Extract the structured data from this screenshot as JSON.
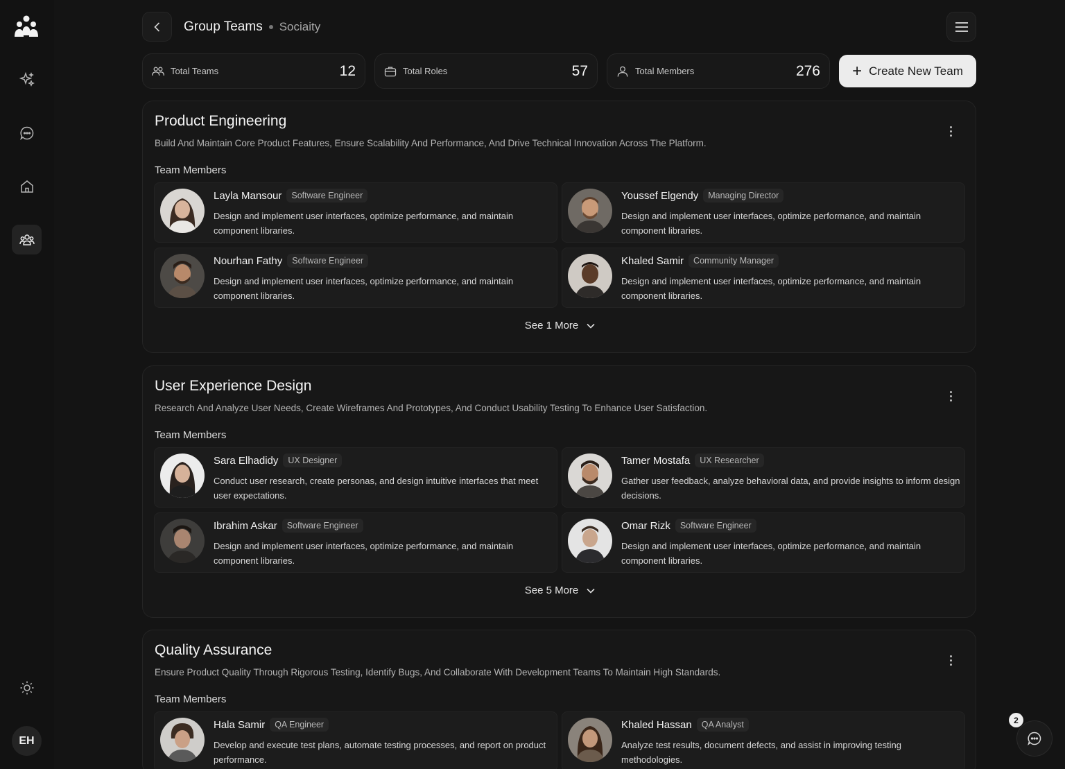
{
  "header": {
    "title": "Group Teams",
    "subtitle": "Sociaity"
  },
  "sidebar": {
    "items": [
      {
        "name": "sparkle-icon"
      },
      {
        "name": "chat-icon"
      },
      {
        "name": "home-icon"
      },
      {
        "name": "teams-icon",
        "active": true
      }
    ],
    "user_initials": "EH"
  },
  "stats": [
    {
      "icon": "teams-icon",
      "label": "Total Teams",
      "value": "12"
    },
    {
      "icon": "briefcase-icon",
      "label": "Total Roles",
      "value": "57"
    },
    {
      "icon": "user-icon",
      "label": "Total Members",
      "value": "276"
    }
  ],
  "create_button": {
    "label": "Create New Team"
  },
  "members_label": "Team Members",
  "teams": [
    {
      "name": "Product Engineering",
      "description": "Build And Maintain Core Product Features, Ensure Scalability And Performance, And Drive Technical Innovation Across The Platform.",
      "members": [
        {
          "name": "Layla Mansour",
          "role": "Software Engineer",
          "description": "Design and implement user interfaces, optimize performance, and maintain component libraries."
        },
        {
          "name": "Youssef Elgendy",
          "role": "Managing Director",
          "description": "Design and implement user interfaces, optimize performance, and maintain component libraries."
        },
        {
          "name": "Nourhan Fathy",
          "role": "Software Engineer",
          "description": "Design and implement user interfaces, optimize performance, and maintain component libraries."
        },
        {
          "name": "Khaled Samir",
          "role": "Community Manager",
          "description": "Design and implement user interfaces, optimize performance, and maintain component libraries."
        }
      ],
      "see_more": "See 1 More"
    },
    {
      "name": "User Experience Design",
      "description": "Research And Analyze User Needs, Create Wireframes And Prototypes, And Conduct Usability Testing To Enhance User Satisfaction.",
      "members": [
        {
          "name": "Sara Elhadidy",
          "role": "UX Designer",
          "description": "Conduct user research, create personas, and design intuitive interfaces that meet user expectations."
        },
        {
          "name": "Tamer Mostafa",
          "role": "UX Researcher",
          "description": "Gather user feedback, analyze behavioral data, and provide insights to inform design decisions."
        },
        {
          "name": "Ibrahim Askar",
          "role": "Software Engineer",
          "description": "Design and implement user interfaces, optimize performance, and maintain component libraries."
        },
        {
          "name": "Omar Rizk",
          "role": "Software Engineer",
          "description": "Design and implement user interfaces, optimize performance, and maintain component libraries."
        }
      ],
      "see_more": "See 5 More"
    },
    {
      "name": "Quality Assurance",
      "description": "Ensure Product Quality Through Rigorous Testing, Identify Bugs, And Collaborate With Development Teams To Maintain High Standards.",
      "members": [
        {
          "name": "Hala Samir",
          "role": "QA Engineer",
          "description": "Develop and execute test plans, automate testing processes, and report on product performance."
        },
        {
          "name": "Khaled Hassan",
          "role": "QA Analyst",
          "description": "Analyze test results, document defects, and assist in improving testing methodologies."
        }
      ],
      "see_more": ""
    }
  ],
  "chat": {
    "badge_count": "2"
  }
}
